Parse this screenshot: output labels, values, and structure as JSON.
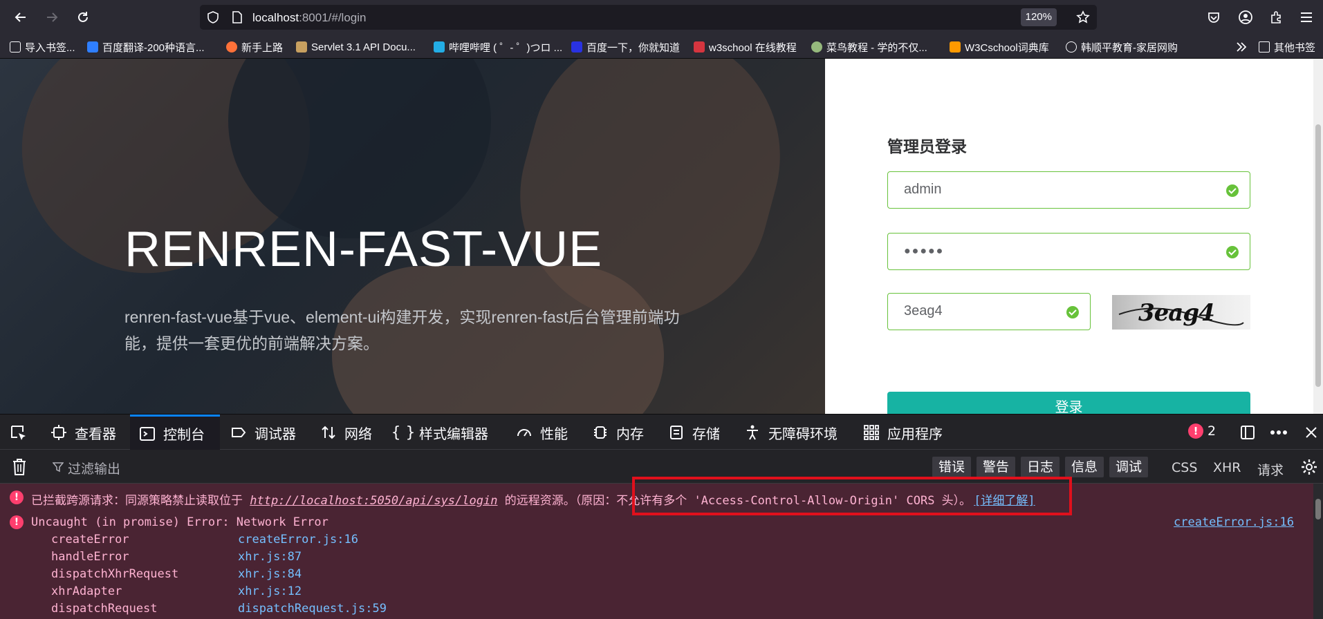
{
  "browser": {
    "url_host": "localhost",
    "url_rest": ":8001/#/login",
    "zoom": "120%"
  },
  "bookmarks": [
    {
      "label": "导入书签...",
      "icon": "import-icon",
      "color": "#ffffff"
    },
    {
      "label": "百度翻译-200种语言...",
      "icon": "baidu-translate-icon",
      "color": "#2f7fff"
    },
    {
      "label": "新手上路",
      "icon": "firefox-icon",
      "color": "#ff7139"
    },
    {
      "label": "Servlet 3.1 API Docu...",
      "icon": "servlet-icon",
      "color": "#c8a060"
    },
    {
      "label": "哔哩哔哩 ( ゜- ゜)つロ ...",
      "icon": "bilibili-icon",
      "color": "#23ade5"
    },
    {
      "label": "百度一下，你就知道",
      "icon": "baidu-icon",
      "color": "#2932e1"
    },
    {
      "label": "w3school 在线教程",
      "icon": "w3school-icon",
      "color": "#d5353f"
    },
    {
      "label": "菜鸟教程 - 学的不仅...",
      "icon": "runoob-icon",
      "color": "#96b97d"
    },
    {
      "label": "W3Cschool词典库",
      "icon": "w3cschool-icon",
      "color": "#ff9a00"
    },
    {
      "label": "韩顺平教育-家居网购",
      "icon": "globe-icon",
      "color": "#ffffff"
    },
    {
      "label": "其他书签",
      "icon": "folder-icon",
      "color": "#ffffff"
    }
  ],
  "hero": {
    "title": "RENREN-FAST-VUE",
    "description": "renren-fast-vue基于vue、element-ui构建开发，实现renren-fast后台管理前端功能，提供一套更优的前端解决方案。"
  },
  "login": {
    "title": "管理员登录",
    "username": "admin",
    "password": "●●●●●",
    "captcha_value": "3eag4",
    "captcha_image_text": "3eag4",
    "submit_label": "登录"
  },
  "devtools": {
    "tabs": [
      {
        "label": "查看器",
        "icon": "inspector-icon"
      },
      {
        "label": "控制台",
        "icon": "console-icon"
      },
      {
        "label": "调试器",
        "icon": "debugger-icon"
      },
      {
        "label": "网络",
        "icon": "network-icon"
      },
      {
        "label": "样式编辑器",
        "icon": "style-editor-icon"
      },
      {
        "label": "性能",
        "icon": "performance-icon"
      },
      {
        "label": "内存",
        "icon": "memory-icon"
      },
      {
        "label": "存储",
        "icon": "storage-icon"
      },
      {
        "label": "无障碍环境",
        "icon": "accessibility-icon"
      },
      {
        "label": "应用程序",
        "icon": "application-icon"
      }
    ],
    "error_count": "2",
    "filter_placeholder": "过滤输出",
    "filter_buttons": [
      "错误",
      "警告",
      "日志",
      "信息",
      "调试"
    ],
    "filter_links": [
      "CSS",
      "XHR",
      "请求"
    ]
  },
  "console": {
    "cors_prefix": "已拦截跨源请求：同源策略禁止读取位于 ",
    "cors_url": "http://localhost:5050/api/sys/login",
    "cors_middle": " 的远程资源。",
    "cors_reason": "（原因：不允许有多个 'Access-Control-Allow-Origin' CORS 头）。",
    "learn_more": "[详细了解]",
    "error_text": "Uncaught (in promise) Error: Network Error",
    "error_source": "createError.js:16",
    "stack": [
      {
        "fn": "createError",
        "src": "createError.js:16"
      },
      {
        "fn": "handleError",
        "src": "xhr.js:87"
      },
      {
        "fn": "dispatchXhrRequest",
        "src": "xhr.js:84"
      },
      {
        "fn": "xhrAdapter",
        "src": "xhr.js:12"
      },
      {
        "fn": "dispatchRequest",
        "src": "dispatchRequest.js:59"
      }
    ]
  }
}
